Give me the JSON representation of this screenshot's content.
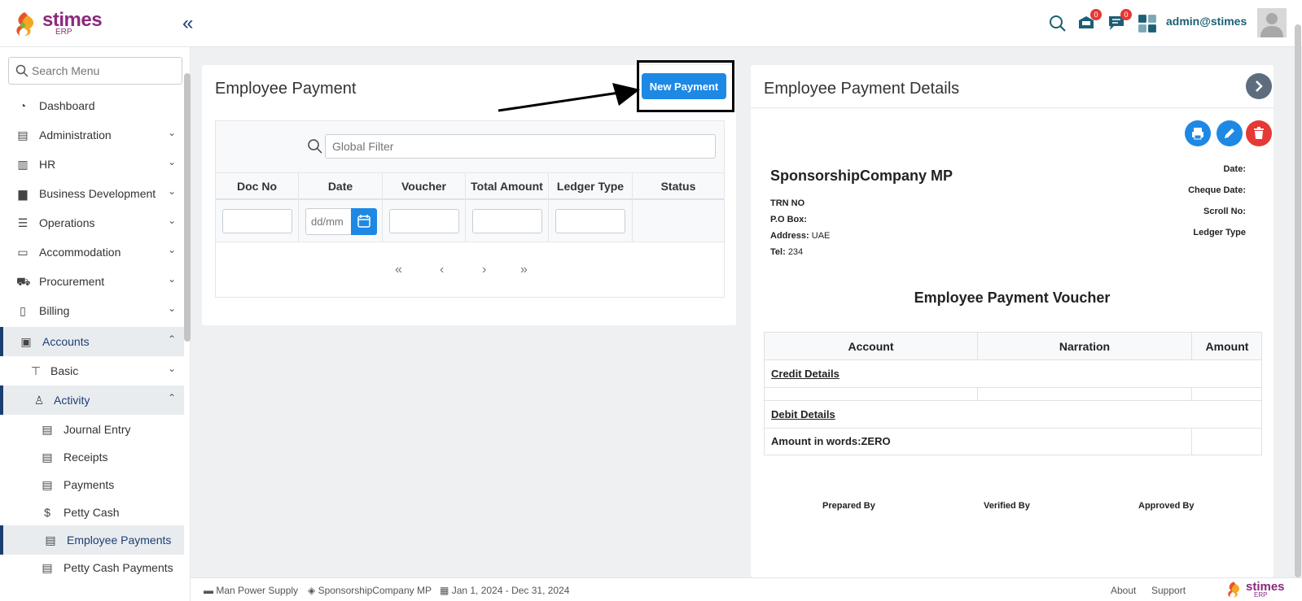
{
  "brand": {
    "name": "stimes",
    "sub": "ERP",
    "collapse_glyph": "«",
    "colors": {
      "brand": "#8b2a7d",
      "accent": "#1e88e5",
      "nav": "#1c3f73",
      "danger": "#e53935"
    }
  },
  "header": {
    "user": "admin@stimes",
    "notif_count": "0",
    "msg_count": "0"
  },
  "sidebar": {
    "search_placeholder": "Search Menu",
    "items": [
      {
        "label": "Dashboard",
        "icon": "dashboard-icon"
      },
      {
        "label": "Administration",
        "icon": "building-icon"
      },
      {
        "label": "HR",
        "icon": "hr-icon"
      },
      {
        "label": "Business Development",
        "icon": "briefcase-icon"
      },
      {
        "label": "Operations",
        "icon": "sliders-icon"
      },
      {
        "label": "Accommodation",
        "icon": "bed-icon"
      },
      {
        "label": "Procurement",
        "icon": "cart-icon"
      },
      {
        "label": "Billing",
        "icon": "invoice-icon"
      },
      {
        "label": "Accounts",
        "icon": "accounts-icon"
      },
      {
        "label": "Basic",
        "icon": "pin-icon"
      },
      {
        "label": "Activity",
        "icon": "walk-icon"
      },
      {
        "label": "Journal Entry",
        "icon": "file-icon"
      },
      {
        "label": "Receipts",
        "icon": "file-icon"
      },
      {
        "label": "Payments",
        "icon": "file-icon"
      },
      {
        "label": "Petty Cash",
        "icon": "hand-coin-icon"
      },
      {
        "label": "Employee Payments",
        "icon": "file-icon"
      },
      {
        "label": "Petty Cash Payments",
        "icon": "file-icon"
      }
    ]
  },
  "list": {
    "title": "Employee Payment",
    "new_button": "New Payment",
    "filter_placeholder": "Global Filter",
    "columns": [
      "Doc No",
      "Date",
      "Voucher",
      "Total Amount",
      "Ledger Type",
      "Status"
    ],
    "date_placeholder": "dd/mm",
    "pager": [
      "«",
      "‹",
      "›",
      "»"
    ]
  },
  "details": {
    "title": "Employee Payment Details",
    "company": "SponsorshipCompany MP",
    "trn_label": "TRN NO",
    "pobox_label": "P.O Box:",
    "address_label": "Address:",
    "address_value": "UAE",
    "tel_label": "Tel:",
    "tel_value": "234",
    "date_label": "Date:",
    "cheque_label": "Cheque Date:",
    "scroll_label": "Scroll No:",
    "ledger_label": "Ledger Type",
    "voucher_title": "Employee Payment Voucher",
    "columns": [
      "Account",
      "Narration",
      "Amount"
    ],
    "credit": "Credit Details",
    "debit": "Debit Details",
    "words": "Amount in words:ZERO",
    "signatures": [
      "Prepared By",
      "Verified By",
      "Approved By"
    ]
  },
  "footer": {
    "module": "Man Power Supply",
    "company": "SponsorshipCompany MP",
    "period": "Jan 1, 2024 - Dec 31, 2024",
    "about": "About",
    "support": "Support"
  }
}
